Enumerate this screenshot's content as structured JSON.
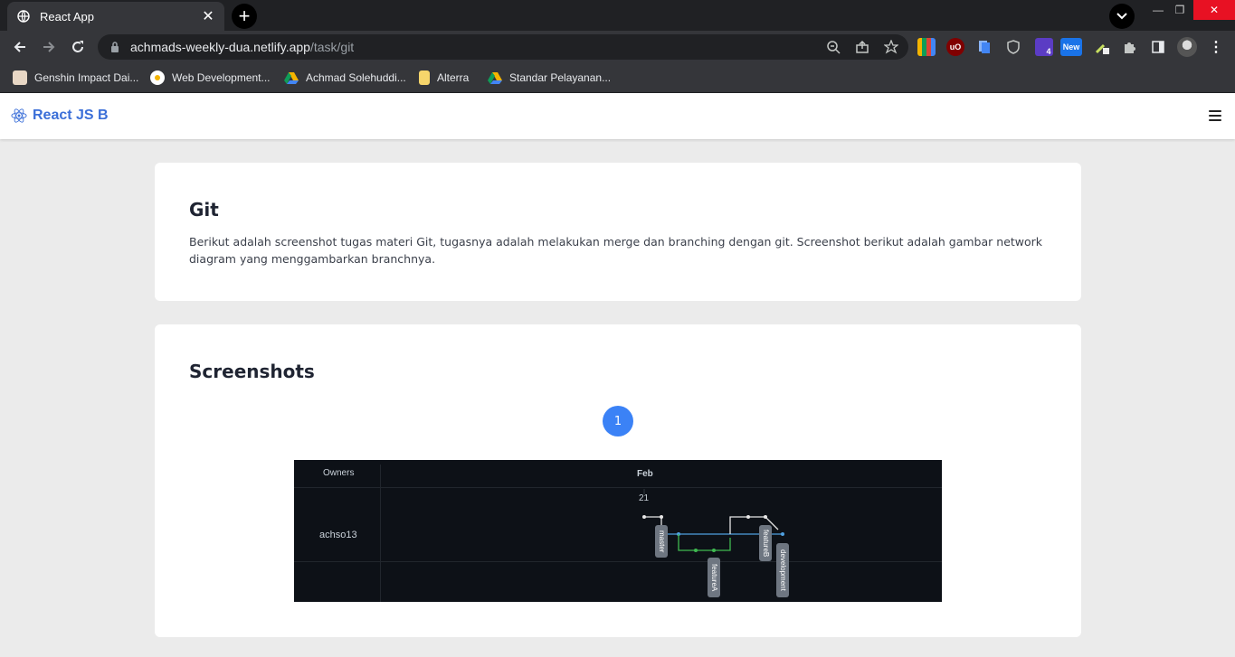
{
  "browser": {
    "tab_title": "React App",
    "url_host": "achmads-weekly-dua.netlify.app",
    "url_path": "/task/git",
    "extension_badges": {
      "badge_count": "4",
      "badge_new": "New"
    },
    "bookmarks": [
      {
        "label": "Genshin Impact Dai...",
        "icon": "genshin-icon"
      },
      {
        "label": "Web Development...",
        "icon": "web-dev-icon"
      },
      {
        "label": "Achmad Solehuddi...",
        "icon": "google-drive-icon"
      },
      {
        "label": "Alterra",
        "icon": "folder-icon"
      },
      {
        "label": "Standar Pelayanan...",
        "icon": "google-drive-icon"
      }
    ]
  },
  "app": {
    "brand": "React JS B",
    "git_card": {
      "title": "Git",
      "description": "Berikut adalah screenshot tugas materi Git, tugasnya adalah melakukan merge dan branching dengan git. Screenshot berikut adalah gambar network diagram yang menggambarkan branchnya."
    },
    "screenshots_card": {
      "title": "Screenshots",
      "page": "1",
      "network": {
        "owners_header": "Owners",
        "month": "Feb",
        "day": "21",
        "owner": "achso13",
        "branches": [
          "master",
          "featureA",
          "featureB",
          "development"
        ]
      }
    }
  },
  "colors": {
    "accent": "#3b82f6",
    "brand": "#3b6fd8",
    "branch_blue": "#4fa0e0",
    "branch_green": "#3fb950"
  }
}
